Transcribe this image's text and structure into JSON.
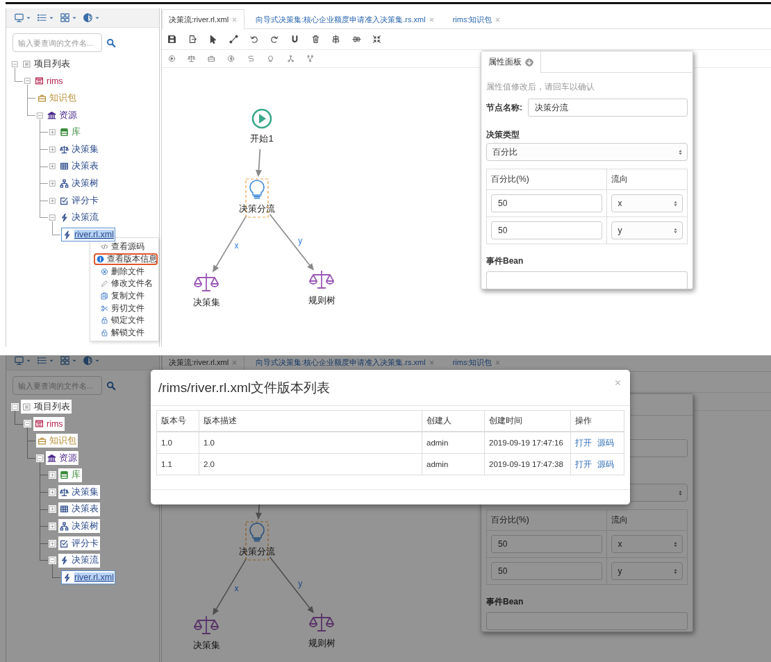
{
  "screens": [
    {
      "tabs": [
        {
          "label": "决策流:river.rl.xml",
          "selected": true
        },
        {
          "label": "向导式决策集:核心企业额度申请准入决策集.rs.xml",
          "selected": false
        },
        {
          "label": "rims:知识包",
          "selected": false
        }
      ],
      "search": {
        "placeholder": "输入要查询的文件名..."
      },
      "tree": [
        {
          "label": "项目列表",
          "kind": "project",
          "expanded": true,
          "selected": false,
          "children": [
            {
              "label": "rims",
              "kind": "package",
              "color": "#b5224d",
              "expanded": true,
              "selected": false,
              "children": [
                {
                  "label": "知识包",
                  "kind": "knowledge",
                  "color": "#b8903a",
                  "selected": false
                },
                {
                  "label": "资源",
                  "kind": "resources",
                  "color": "#4b2a8c",
                  "expanded": true,
                  "selected": false,
                  "children": [
                    {
                      "label": "库",
                      "kind": "library",
                      "color": "#3a8a3a",
                      "expanded": false,
                      "selected": false
                    },
                    {
                      "label": "决策集",
                      "kind": "ruleset",
                      "color": "#2b4a8b",
                      "expanded": false,
                      "selected": false
                    },
                    {
                      "label": "决策表",
                      "kind": "table",
                      "color": "#2b4a8b",
                      "expanded": false,
                      "selected": false
                    },
                    {
                      "label": "决策树",
                      "kind": "tree",
                      "color": "#2b4a8b",
                      "expanded": false,
                      "selected": false
                    },
                    {
                      "label": "评分卡",
                      "kind": "scorecard",
                      "color": "#2b4a8b",
                      "expanded": false,
                      "selected": false
                    },
                    {
                      "label": "决策流",
                      "kind": "flow",
                      "color": "#2b4a8b",
                      "expanded": true,
                      "selected": false,
                      "children": [
                        {
                          "label": "river.rl.xml",
                          "kind": "file",
                          "color": "#2b4a8b",
                          "selected": true
                        }
                      ]
                    }
                  ]
                }
              ]
            }
          ]
        }
      ],
      "canvas": {
        "nodes": [
          {
            "kind": "start",
            "label": "开始1",
            "selected": false
          },
          {
            "kind": "split",
            "label": "决策分流",
            "selected": true
          },
          {
            "kind": "ruleset",
            "label": "决策集",
            "selected": false
          },
          {
            "kind": "ruletree",
            "label": "规则树",
            "selected": false
          }
        ],
        "edges": [
          {
            "kind": "entry"
          },
          {
            "kind": "left",
            "label": "x"
          },
          {
            "kind": "right",
            "label": "y"
          }
        ]
      },
      "properties": {
        "title": "属性面板",
        "hint": "属性值修改后，请回车以确认",
        "name_label": "节点名称:",
        "name_value": "决策分流",
        "type_label": "决策类型",
        "type_value": "百分比",
        "columns": [
          "百分比(%)",
          "流向"
        ],
        "rows": [
          {
            "percent": "50",
            "direction": "x"
          },
          {
            "percent": "50",
            "direction": "y"
          }
        ],
        "event_label": "事件Bean"
      },
      "context_menu": [
        {
          "label": "查看源码",
          "kind": "source",
          "highlighted": false
        },
        {
          "label": "查看版本信息",
          "kind": "info",
          "highlighted": true
        },
        {
          "label": "删除文件",
          "kind": "delete",
          "highlighted": false
        },
        {
          "label": "修改文件名",
          "kind": "rename",
          "highlighted": false
        },
        {
          "label": "复制文件",
          "kind": "copy",
          "highlighted": false
        },
        {
          "label": "剪切文件",
          "kind": "cut",
          "highlighted": false
        },
        {
          "label": "锁定文件",
          "kind": "lock",
          "highlighted": false
        },
        {
          "label": "解锁文件",
          "kind": "unlock",
          "highlighted": false
        }
      ]
    },
    {
      "tabs": [
        {
          "label": "决策流:river.rl.xml",
          "selected": true
        },
        {
          "label": "向导式决策集:核心企业额度申请准入决策集.rs.xml",
          "selected": false
        },
        {
          "label": "rims:知识包",
          "selected": false
        }
      ],
      "search": {
        "placeholder": "输入要查询的文件名..."
      },
      "tree": [
        {
          "label": "项目列表",
          "kind": "project",
          "expanded": true,
          "selected": false,
          "children": [
            {
              "label": "rims",
              "kind": "package",
              "color": "#b5224d",
              "expanded": true,
              "selected": false,
              "children": [
                {
                  "label": "知识包",
                  "kind": "knowledge",
                  "color": "#b8903a",
                  "selected": false
                },
                {
                  "label": "资源",
                  "kind": "resources",
                  "color": "#4b2a8c",
                  "expanded": true,
                  "selected": false,
                  "children": [
                    {
                      "label": "库",
                      "kind": "library",
                      "color": "#3a8a3a",
                      "expanded": false,
                      "selected": false
                    },
                    {
                      "label": "决策集",
                      "kind": "ruleset",
                      "color": "#2b4a8b",
                      "expanded": false,
                      "selected": false
                    },
                    {
                      "label": "决策表",
                      "kind": "table",
                      "color": "#2b4a8b",
                      "expanded": false,
                      "selected": false
                    },
                    {
                      "label": "决策树",
                      "kind": "tree",
                      "color": "#2b4a8b",
                      "expanded": false,
                      "selected": false
                    },
                    {
                      "label": "评分卡",
                      "kind": "scorecard",
                      "color": "#2b4a8b",
                      "expanded": false,
                      "selected": false
                    },
                    {
                      "label": "决策流",
                      "kind": "flow",
                      "color": "#2b4a8b",
                      "expanded": true,
                      "selected": false,
                      "children": [
                        {
                          "label": "river.rl.xml",
                          "kind": "file",
                          "color": "#2b4a8b",
                          "selected": true
                        }
                      ]
                    }
                  ]
                }
              ]
            }
          ]
        }
      ],
      "canvas": {
        "nodes": [
          {
            "kind": "split",
            "label": "决策分流",
            "selected": true
          },
          {
            "kind": "ruleset",
            "label": "决策集",
            "selected": false
          },
          {
            "kind": "ruletree",
            "label": "规则树",
            "selected": false
          }
        ],
        "edges": [
          {
            "kind": "entry"
          },
          {
            "kind": "left",
            "label": "x"
          },
          {
            "kind": "right",
            "label": "y"
          }
        ]
      },
      "properties": {
        "columns": [
          "百分比(%)",
          "流向"
        ],
        "rows": [
          {
            "percent": "50",
            "direction": "x"
          },
          {
            "percent": "50",
            "direction": "y"
          }
        ],
        "event_label": "事件Bean"
      },
      "dialog": {
        "title": "/rims/river.rl.xml文件版本列表",
        "columns": [
          "版本号",
          "版本描述",
          "创建人",
          "创建时间",
          "操作"
        ],
        "rows": [
          {
            "version": "1.0",
            "description": "1.0",
            "creator": "admin",
            "time": "2019-09-19 17:47:16",
            "actions": [
              "打开",
              "源码"
            ]
          },
          {
            "version": "1.1",
            "description": "2.0",
            "creator": "admin",
            "time": "2019-09-19 17:47:38",
            "actions": [
              "打开",
              "源码"
            ]
          }
        ]
      }
    }
  ]
}
